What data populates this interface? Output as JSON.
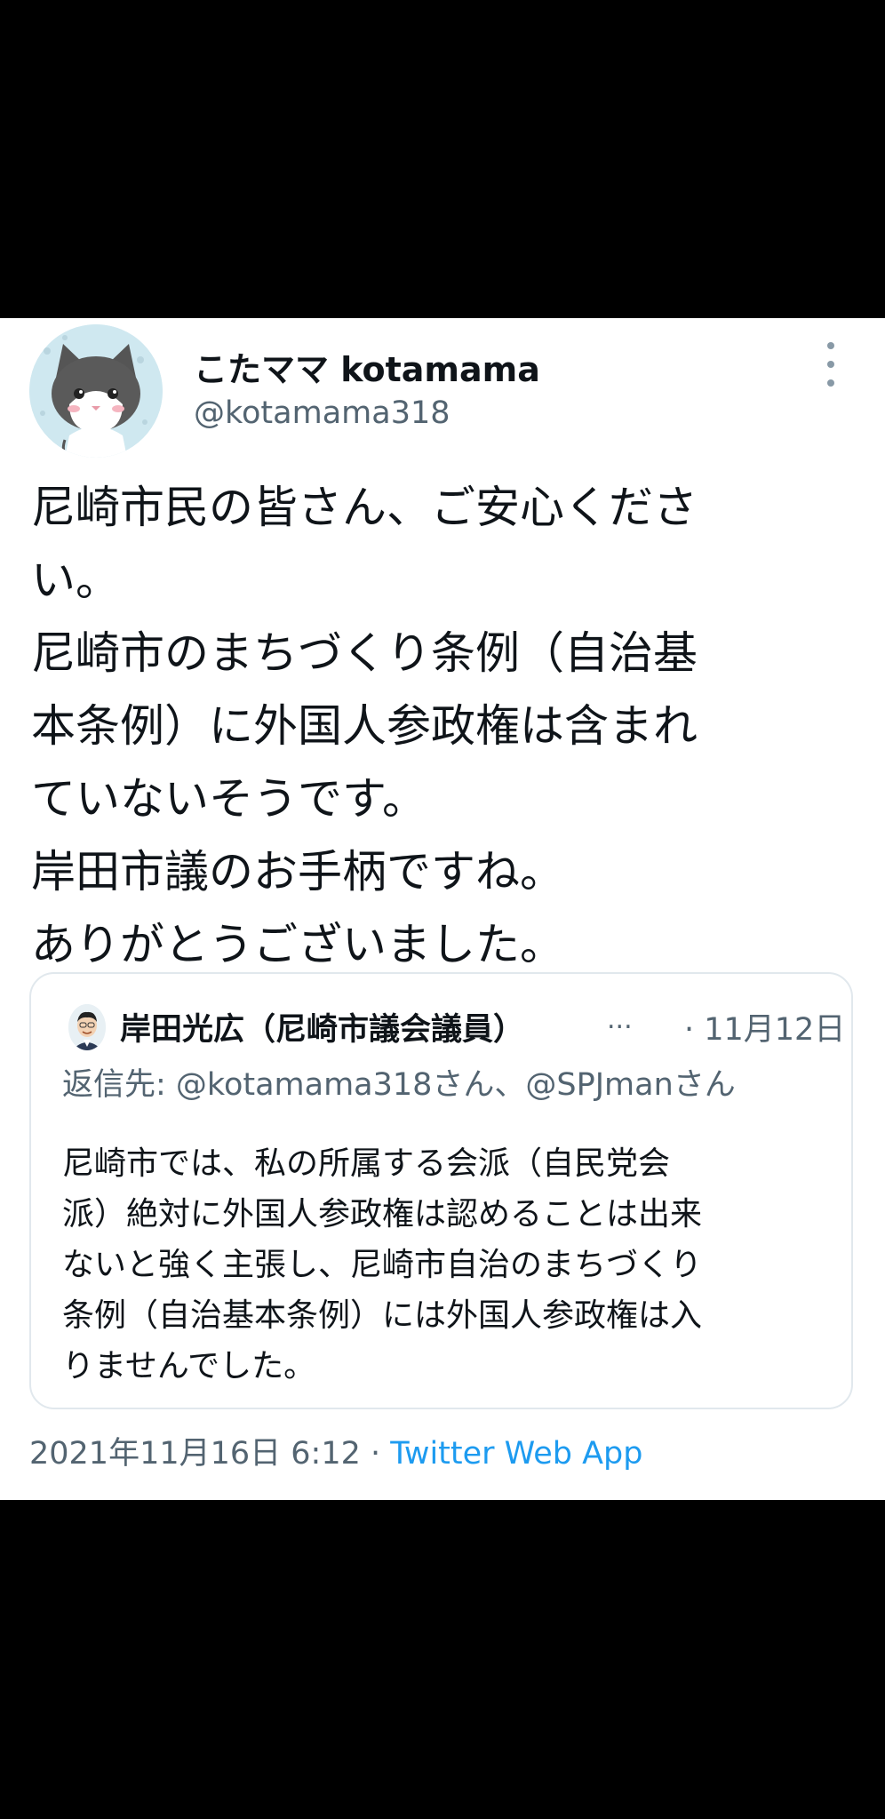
{
  "author": {
    "display_name": "こたママ kotamama",
    "handle": "@kotamama318"
  },
  "tweet": {
    "lines": [
      "尼崎市民の皆さん、ご安心くださ",
      "い。",
      "尼崎市のまちづくり条例（自治基",
      "本条例）に外国人参政権は含まれ",
      "ていないそうです。",
      "岸田市議のお手柄ですね。",
      "ありがとうございました。"
    ]
  },
  "quoted": {
    "author_name": "岸田光広（尼崎市議会議員）",
    "ellipsis": "...",
    "date": "· 11月12日",
    "reply_prefix": "返信先: ",
    "reply_mentions": "@kotamama318さん、@SPJmanさん",
    "lines": [
      "尼崎市では、私の所属する会派（自民党会",
      "派）絶対に外国人参政権は認めることは出来",
      "ないと強く主張し、尼崎市自治のまちづくり",
      "条例（自治基本条例）には外国人参政権は入",
      "りませんでした。"
    ]
  },
  "meta": {
    "timestamp": "2021年11月16日 6:12 · ",
    "source": "Twitter Web App"
  },
  "icons": {
    "avatar": "cat-avatar-icon",
    "quoted_avatar": "person-avatar-icon",
    "more": "more-vertical-icon"
  },
  "colors": {
    "text": "#0f1419",
    "secondary": "#536471",
    "link": "#1d9bf0",
    "border": "#e1e8ed"
  }
}
